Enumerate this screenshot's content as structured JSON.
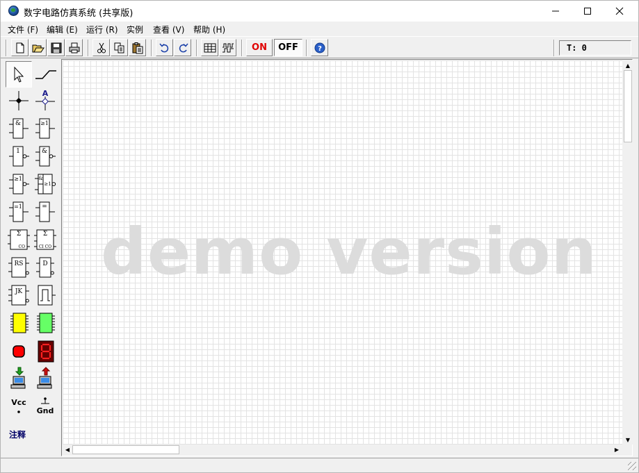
{
  "window": {
    "title": "数字电路仿真系统 (共享版)"
  },
  "menu": [
    {
      "label": "文件 (F)"
    },
    {
      "label": "编辑 (E)"
    },
    {
      "label": "运行 (R)"
    },
    {
      "label": "实例"
    },
    {
      "label": "查看 (V)"
    },
    {
      "label": "帮助 (H)"
    }
  ],
  "toolbar": {
    "on_label": "ON",
    "off_label": "OFF",
    "time_readout": "T: 0",
    "colors": {
      "on": "#e00000",
      "off": "#000000"
    }
  },
  "palette": {
    "vcc_label": "Vcc",
    "gnd_label": "Gnd",
    "note_label": "注释",
    "text_tool_label": "A",
    "and_label": "&",
    "or_label": "≥1",
    "not_label": "1",
    "nand_label": "&",
    "nor_label": "≥1",
    "andor_label": "&",
    "xor_label": "=1",
    "xnor_label": "=",
    "half_adder_label": "Σ",
    "half_adder_out": "CO",
    "full_adder_label": "Σ",
    "full_adder_io": "CI CO",
    "rs_label": "RS",
    "d_label": "D",
    "jk_label": "JK",
    "colors": {
      "yellow_chip": "#ffff00",
      "green_chip": "#66ff66",
      "led": "#ff0000",
      "seven_seg": "#ff0000"
    }
  },
  "canvas": {
    "watermark": "demo version"
  }
}
